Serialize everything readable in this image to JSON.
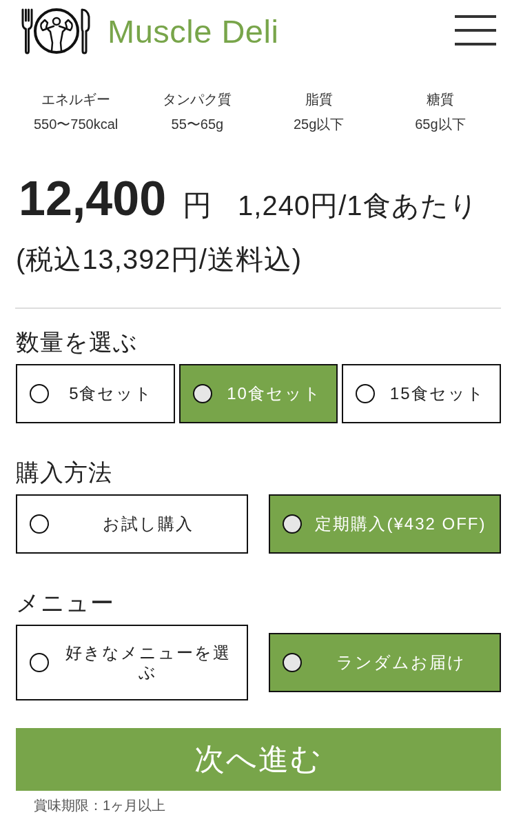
{
  "header": {
    "logo_text": "Muscle Deli"
  },
  "nutrition": [
    {
      "label": "エネルギー",
      "value": "550〜750kcal"
    },
    {
      "label": "タンパク質",
      "value": "55〜65g"
    },
    {
      "label": "脂質",
      "value": "25g以下"
    },
    {
      "label": "糖質",
      "value": "65g以下"
    }
  ],
  "price": {
    "amount": "12,400",
    "currency": "円",
    "per_meal": "1,240円/1食あたり",
    "tax_note": "(税込13,392円/送料込)"
  },
  "option_groups": [
    {
      "title": "数量を選ぶ",
      "options": [
        {
          "label": "5食セット",
          "selected": false
        },
        {
          "label": "10食セット",
          "selected": true
        },
        {
          "label": "15食セット",
          "selected": false
        }
      ]
    },
    {
      "title": "購入方法",
      "options": [
        {
          "label": "お試し購入",
          "selected": false
        },
        {
          "label": "定期購入(¥432 OFF)",
          "selected": true
        }
      ]
    },
    {
      "title": "メニュー",
      "options": [
        {
          "label": "好きなメニューを選ぶ",
          "selected": false
        },
        {
          "label": "ランダムお届け",
          "selected": true
        }
      ]
    }
  ],
  "next_button": {
    "label": "次へ進む"
  },
  "footnote": "賞味期限：1ヶ月以上"
}
